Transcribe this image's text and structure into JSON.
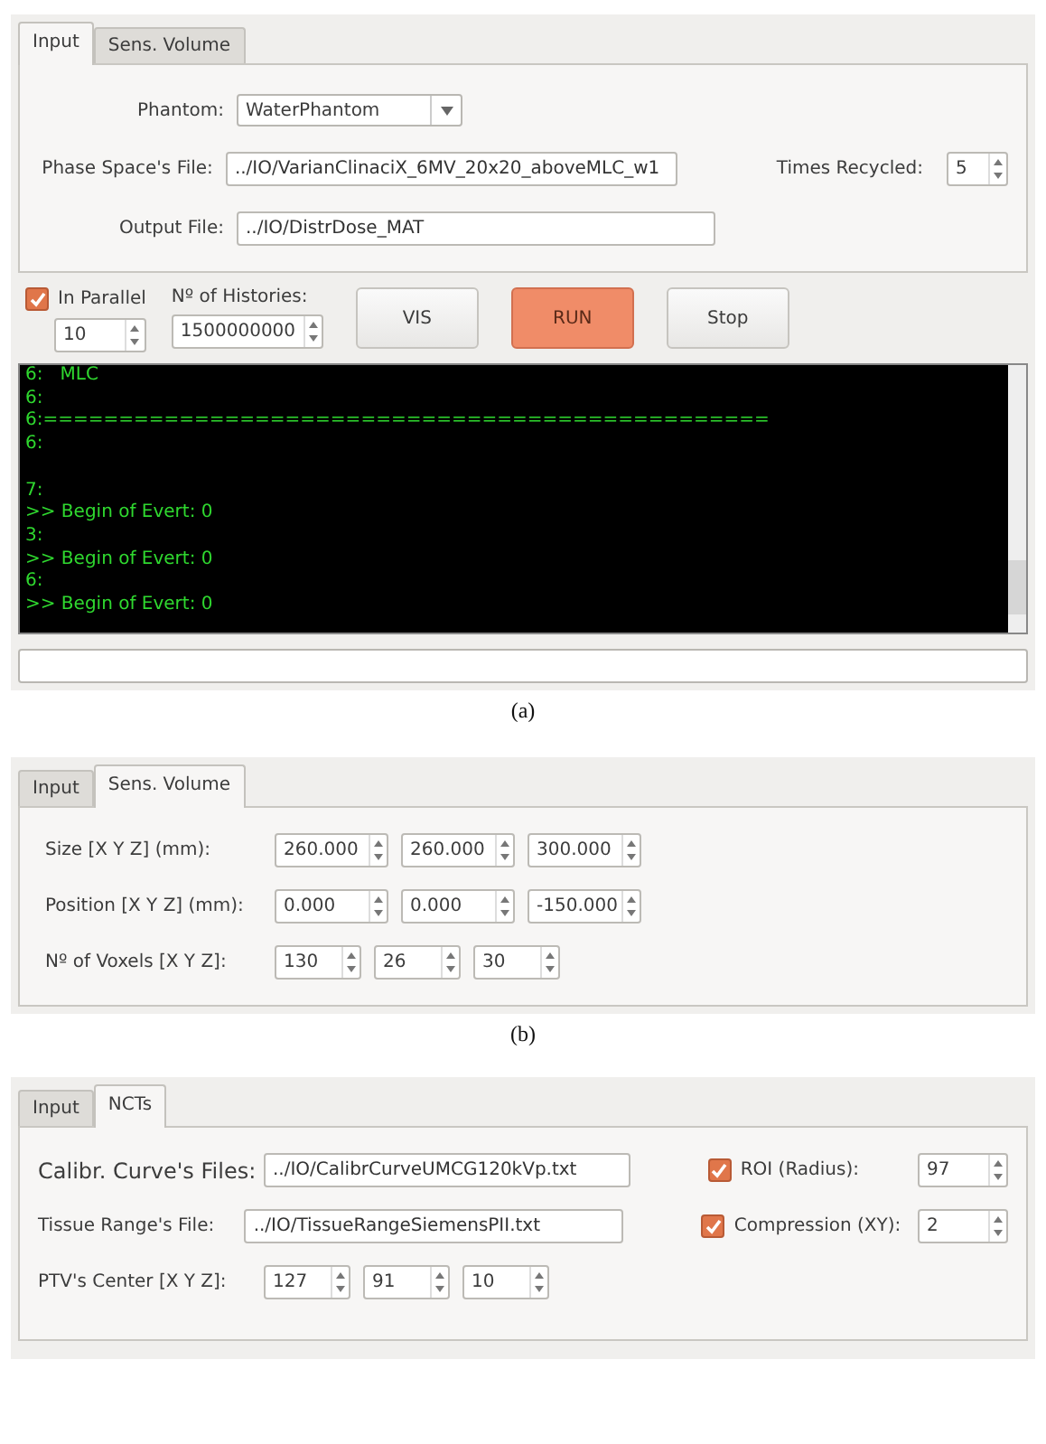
{
  "panel_a": {
    "tabs": [
      {
        "label": "Input",
        "selected": true
      },
      {
        "label": "Sens. Volume",
        "selected": false
      }
    ],
    "phantom": {
      "label": "Phantom:",
      "value": "WaterPhantom"
    },
    "phase_space": {
      "label": "Phase Space's File:",
      "value": "../IO/VarianClinaciX_6MV_20x20_aboveMLC_w1"
    },
    "times_recycled": {
      "label": "Times Recycled:",
      "value": "5"
    },
    "output_file": {
      "label": "Output File:",
      "value": "../IO/DistrDose_MAT"
    },
    "parallel": {
      "label": "In Parallel",
      "checked": true,
      "value": "10"
    },
    "histories": {
      "label": "Nº of Histories:",
      "value": "1500000000"
    },
    "buttons": [
      {
        "label": "VIS",
        "primary": false
      },
      {
        "label": "RUN",
        "primary": true
      },
      {
        "label": "Stop",
        "primary": false
      }
    ],
    "console": [
      [
        "6:   MLC",
        "6:",
        "6:================================================",
        "6:"
      ],
      [
        "7:",
        ">> Begin of Evert: 0",
        "3:",
        ">> Begin of Evert: 0",
        "6:",
        ">> Begin of Evert: 0"
      ]
    ],
    "caption": "(a)"
  },
  "panel_b": {
    "tabs": [
      {
        "label": "Input",
        "selected": false
      },
      {
        "label": "Sens. Volume",
        "selected": true
      }
    ],
    "rows": [
      {
        "label": "Size [X Y Z] (mm):",
        "values": [
          "260.000",
          "260.000",
          "300.000"
        ]
      },
      {
        "label": "Position [X Y Z] (mm):",
        "values": [
          "0.000",
          "0.000",
          "-150.000"
        ]
      },
      {
        "label": "Nº of Voxels [X Y Z]:",
        "values": [
          "130",
          "26",
          "30"
        ]
      }
    ],
    "caption": "(b)"
  },
  "panel_c": {
    "tabs": [
      {
        "label": "Input",
        "selected": false
      },
      {
        "label": "NCTs",
        "selected": true
      }
    ],
    "files": [
      {
        "label": "Calibr. Curve's Files:",
        "value": "../IO/CalibrCurveUMCG120kVp.txt"
      },
      {
        "label": "Tissue Range's File:",
        "value": "../IO/TissueRangeSiemensPII.txt"
      }
    ],
    "options": [
      {
        "label": "ROI (Radius):",
        "checked": true,
        "value": "97"
      },
      {
        "label": "Compression (XY):",
        "checked": true,
        "value": "2"
      }
    ],
    "center": {
      "label": "PTV's Center [X Y Z]:",
      "values": [
        "127",
        "91",
        "10"
      ]
    }
  }
}
